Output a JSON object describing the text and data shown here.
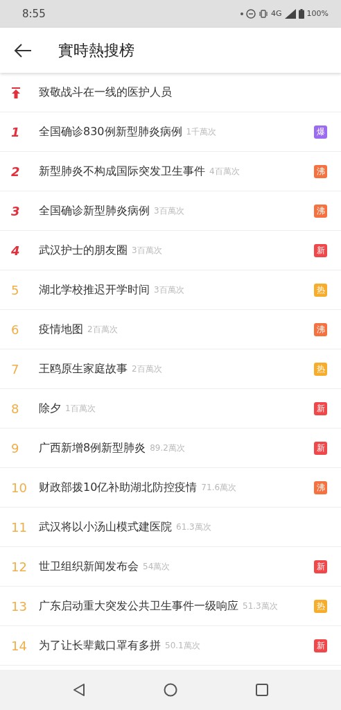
{
  "status_bar": {
    "time": "8:55",
    "network": "4G",
    "battery": "100%"
  },
  "toolbar": {
    "title": "實時熱搜榜"
  },
  "items": [
    {
      "kind": "pinned",
      "title": "致敬战斗在一线的医护人员"
    },
    {
      "kind": "top",
      "rank": "1",
      "title": "全国确诊830例新型肺炎病例",
      "count": "1千萬次",
      "badge": {
        "label": "爆",
        "color": "#9b6cf0"
      }
    },
    {
      "kind": "top",
      "rank": "2",
      "title": "新型肺炎不构成国际突发卫生事件",
      "count": "4百萬次",
      "badge": {
        "label": "沸",
        "color": "#f5713f"
      }
    },
    {
      "kind": "top",
      "rank": "3",
      "title": "全国确诊新型肺炎病例",
      "count": "3百萬次",
      "badge": {
        "label": "沸",
        "color": "#f5713f"
      }
    },
    {
      "kind": "top",
      "rank": "4",
      "title": "武汉护士的朋友圈",
      "count": "3百萬次",
      "badge": {
        "label": "新",
        "color": "#f0474b"
      }
    },
    {
      "kind": "normal",
      "rank": "5",
      "title": "湖北学校推迟开学时间",
      "count": "3百萬次",
      "badge": {
        "label": "热",
        "color": "#f7ad2c"
      }
    },
    {
      "kind": "normal",
      "rank": "6",
      "title": "疫情地图",
      "count": "2百萬次",
      "badge": {
        "label": "沸",
        "color": "#f5713f"
      }
    },
    {
      "kind": "normal",
      "rank": "7",
      "title": "王鸥原生家庭故事",
      "count": "2百萬次",
      "badge": {
        "label": "热",
        "color": "#f7ad2c"
      }
    },
    {
      "kind": "normal",
      "rank": "8",
      "title": "除夕",
      "count": "1百萬次",
      "badge": {
        "label": "新",
        "color": "#f0474b"
      }
    },
    {
      "kind": "normal",
      "rank": "9",
      "title": "广西新增8例新型肺炎",
      "count": "89.2萬次",
      "badge": {
        "label": "新",
        "color": "#f0474b"
      }
    },
    {
      "kind": "normal",
      "rank": "10",
      "title": "财政部拨10亿补助湖北防控疫情",
      "count": "71.6萬次",
      "badge": {
        "label": "沸",
        "color": "#f5713f"
      }
    },
    {
      "kind": "normal",
      "rank": "11",
      "title": "武汉将以小汤山模式建医院",
      "count": "61.3萬次"
    },
    {
      "kind": "normal",
      "rank": "12",
      "title": "世卫组织新闻发布会",
      "count": "54萬次",
      "badge": {
        "label": "新",
        "color": "#f0474b"
      }
    },
    {
      "kind": "normal",
      "rank": "13",
      "title": "广东启动重大突发公共卫生事件一级响应",
      "count": "51.3萬次",
      "badge": {
        "label": "热",
        "color": "#f7ad2c"
      }
    },
    {
      "kind": "normal",
      "rank": "14",
      "title": "为了让长辈戴口罩有多拼",
      "count": "50.1萬次",
      "badge": {
        "label": "新",
        "color": "#f0474b"
      }
    }
  ]
}
